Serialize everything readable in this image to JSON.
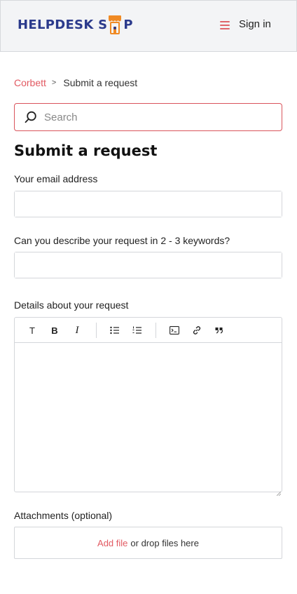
{
  "header": {
    "logo_text_left": "HELPDESK S",
    "logo_text_right": "P",
    "sign_in_label": "Sign in",
    "menu_icon": "hamburger-menu-icon"
  },
  "breadcrumb": {
    "items": [
      "Corbett",
      "Submit a request"
    ],
    "separator": ">"
  },
  "search": {
    "placeholder": "Search",
    "icon": "search-icon"
  },
  "form": {
    "title": "Submit a request",
    "email_label": "Your email address",
    "email_value": "",
    "subject_label": "Can you describe your request in 2 - 3 keywords?",
    "subject_value": "",
    "details_label": "Details about your request",
    "toolbar_text_buttons": [
      "T",
      "B",
      "I"
    ],
    "toolbar_icons": [
      "text-format-icon",
      "bold-icon",
      "italic-icon",
      "bulleted-list-icon",
      "numbered-list-icon",
      "code-block-icon",
      "link-icon",
      "quote-icon"
    ],
    "attachments_label": "Attachments (optional)",
    "add_file_label": "Add file",
    "drop_files_label": "or drop files here"
  },
  "colors": {
    "accent": "#e25a62",
    "brand_blue": "#2b3a8c",
    "brand_orange": "#f08a24",
    "header_bg": "#f3f4f6",
    "border": "#d4d6da"
  }
}
